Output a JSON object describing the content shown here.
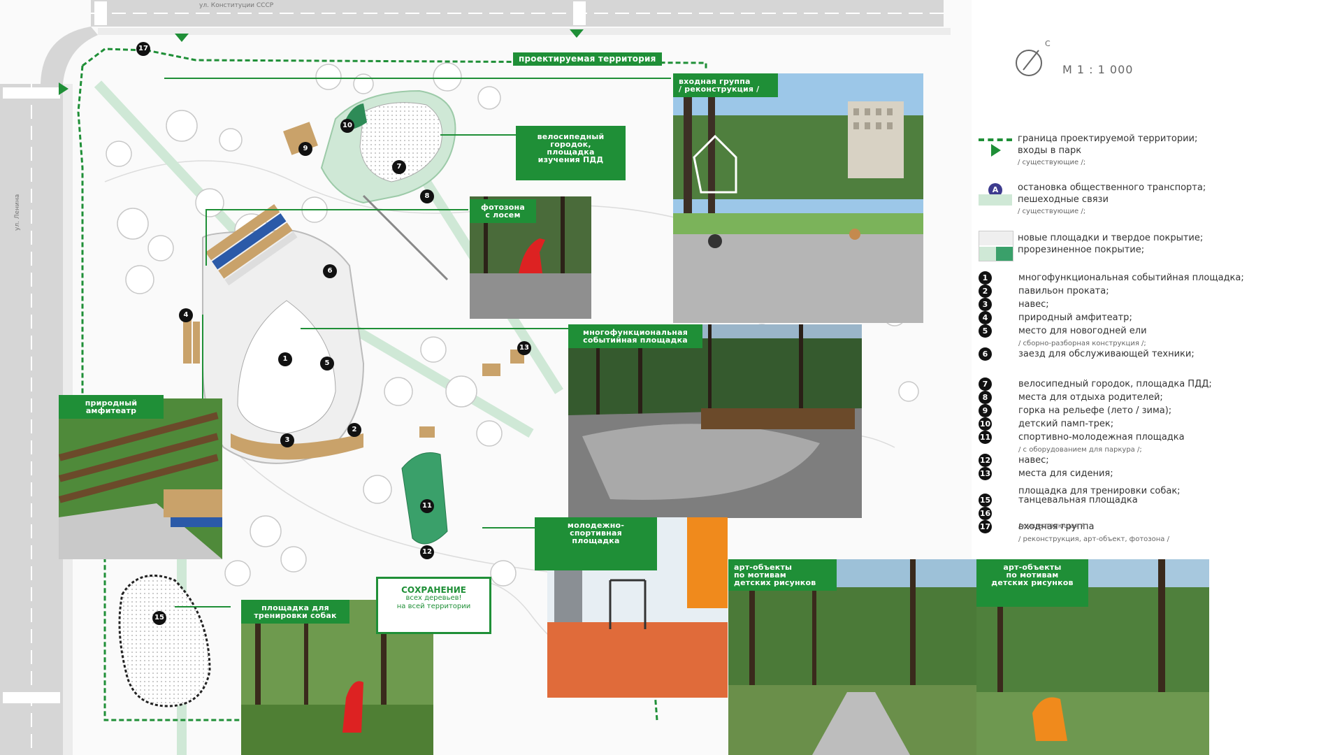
{
  "street_top": "ул. Конституции СССР",
  "street_left": "ул. Ленина",
  "territory_label": "проектируемая территория",
  "scale": {
    "north": "С",
    "text": "М  1 : 1 000"
  },
  "labels": {
    "entrance": [
      "входная группа",
      "/ реконструкция /"
    ],
    "velo": [
      "велосипедный",
      "городок,",
      "площадка",
      "изучения ПДД"
    ],
    "photozone": [
      "фотозона",
      "с лосем"
    ],
    "multi": [
      "многофункциональная",
      "событийная площадка"
    ],
    "amphi": [
      "природный",
      "амфитеатр"
    ],
    "youth": [
      "молодежно-",
      "спортивная",
      "площадка"
    ],
    "art1": [
      "арт-объекты",
      "по мотивам",
      "детских рисунков"
    ],
    "art2": [
      "арт-объекты",
      "по мотивам",
      "детских рисунков"
    ],
    "dogs": [
      "площадка для",
      "тренировки собак"
    ]
  },
  "note": {
    "title": "СОХРАНЕНИЕ",
    "line1": "всех деревьев!",
    "line2": "на всей территории"
  },
  "map_numbers": [
    "1",
    "2",
    "3",
    "4",
    "5",
    "6",
    "7",
    "8",
    "9",
    "10",
    "11",
    "12",
    "13",
    "15",
    "17"
  ],
  "legend": {
    "boundary": {
      "l1": "граница проектируемой территории;",
      "l2": "входы в парк",
      "l3": "/ существующие /;"
    },
    "transport": {
      "icon": "А",
      "l1": "остановка общественного транспорта;",
      "l2": "пешеходные связи",
      "l3": "/ существующие /;"
    },
    "surface": {
      "l1": "новые площадки и твердое покрытие;",
      "l2": "прорезиненное покрытие;"
    },
    "items": [
      {
        "n": "1",
        "t": "многофункциональная событийная площадка;"
      },
      {
        "n": "2",
        "t": "павильон проката;"
      },
      {
        "n": "3",
        "t": "навес;"
      },
      {
        "n": "4",
        "t": "природный амфитеатр;"
      },
      {
        "n": "5",
        "t": "место для новогодней ели",
        "s": "/ сборно-разборная конструкция /;"
      },
      {
        "n": "6",
        "t": "заезд для обслуживающей техники;"
      },
      {
        "n": "7",
        "t": "велосипедный городок, площадка ПДД;"
      },
      {
        "n": "8",
        "t": "места для отдыха родителей;"
      },
      {
        "n": "9",
        "t": "горка на рельефе (лето / зима);"
      },
      {
        "n": "10",
        "t": "детский памп-трек;"
      },
      {
        "n": "11",
        "t": "спортивно-молодежная площадка",
        "s": "/ с оборудованием для паркура /;"
      },
      {
        "n": "12",
        "t": "навес;"
      },
      {
        "n": "13",
        "t": "места для сидения;"
      },
      {
        "n": "",
        "t": "площадка для тренировки собак;"
      },
      {
        "n": "15",
        "t": "танцевальная площадка"
      },
      {
        "n": "16",
        "t": "",
        "s": "/ существующая /"
      },
      {
        "n": "17",
        "t": "входная группа",
        "s": "/ реконструкция, арт-объект, фотозона /"
      }
    ]
  },
  "colors": {
    "green": "#1f8f37",
    "light_green": "#cfe8d6",
    "road": "#d9d9d9",
    "plaza": "#efefef",
    "wood": "#c9a26a"
  },
  "icons": [
    "compass-icon",
    "entrance-arrow-icon",
    "bus-stop-icon"
  ]
}
